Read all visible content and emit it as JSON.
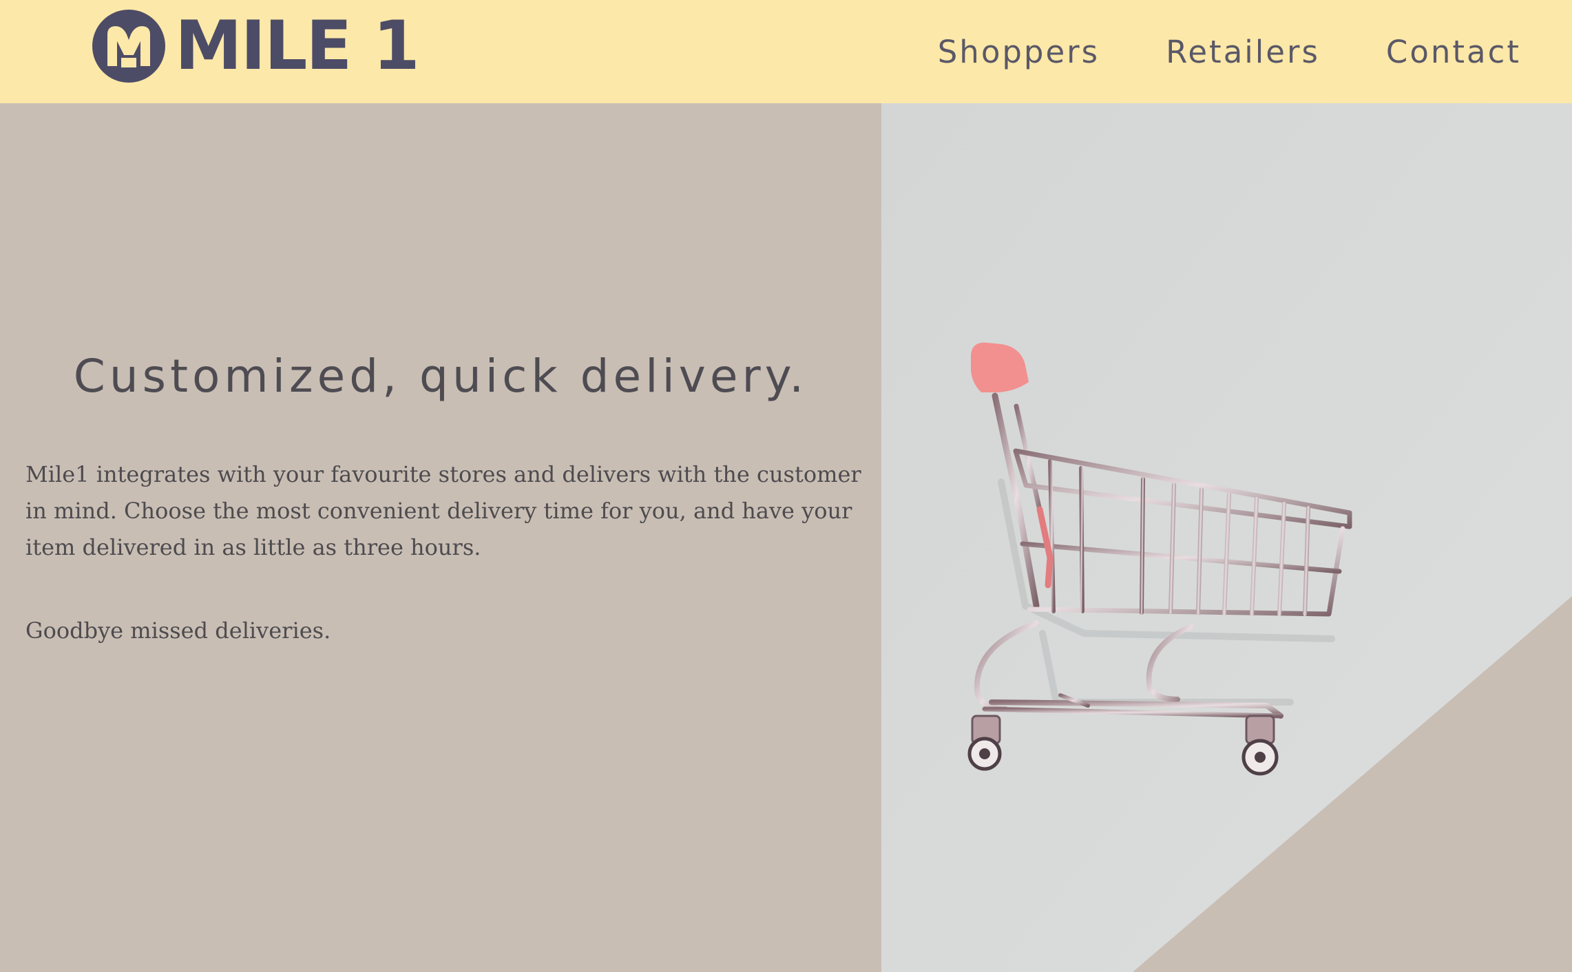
{
  "header": {
    "logo_text": "MILE 1",
    "nav": [
      {
        "label": "Shoppers"
      },
      {
        "label": "Retailers"
      },
      {
        "label": "Contact"
      }
    ]
  },
  "hero": {
    "headline": "Customized, quick delivery.",
    "paragraph": "Mile1 integrates with your favourite stores and delivers with the customer in mind. Choose the most convenient delivery time for you, and have your item delivered in as little as three hours.",
    "tagline": "Goodbye missed deliveries."
  },
  "colors": {
    "header_bg": "#fce8a8",
    "brand": "#4d4c66",
    "left_bg": "#c9beb4",
    "right_bg": "#d7d9d8",
    "cart_handle": "#f2908f",
    "cart_metal": "#b99aa0"
  },
  "icons": {
    "logo_mark": "m-circle-logo-icon",
    "hero_image": "shopping-cart-illustration"
  }
}
